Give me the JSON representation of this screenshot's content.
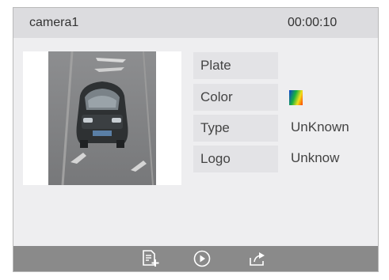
{
  "camera": {
    "name": "camera1",
    "time": "00:00:10"
  },
  "snapshot": {
    "alt": "vehicle-snapshot"
  },
  "attributes": [
    {
      "label": "Plate",
      "value": ""
    },
    {
      "label": "Color",
      "value": ""
    },
    {
      "label": "Type",
      "value": "UnKnown"
    },
    {
      "label": "Logo",
      "value": "Unknow"
    }
  ],
  "color_swatch": {
    "gradient": [
      "#0b3fd0",
      "#18b040",
      "#f2e01a",
      "#ff3b00"
    ]
  },
  "footer": {
    "icons": [
      "export-icon",
      "play-icon",
      "share-icon"
    ]
  },
  "colors": {
    "header_bg": "#dcdcdf",
    "panel_bg": "#eeeef0",
    "footer_bg": "#8a8a8a",
    "label_bg": "#e3e3e6"
  }
}
